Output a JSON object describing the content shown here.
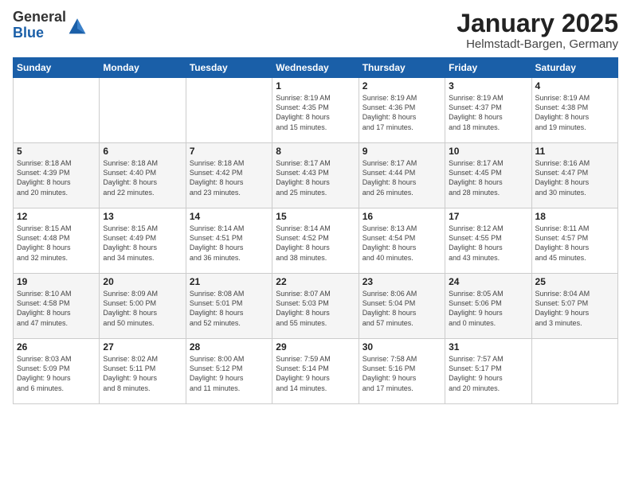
{
  "logo": {
    "general": "General",
    "blue": "Blue"
  },
  "header": {
    "month": "January 2025",
    "location": "Helmstadt-Bargen, Germany"
  },
  "weekdays": [
    "Sunday",
    "Monday",
    "Tuesday",
    "Wednesday",
    "Thursday",
    "Friday",
    "Saturday"
  ],
  "weeks": [
    [
      {
        "day": "",
        "info": ""
      },
      {
        "day": "",
        "info": ""
      },
      {
        "day": "",
        "info": ""
      },
      {
        "day": "1",
        "info": "Sunrise: 8:19 AM\nSunset: 4:35 PM\nDaylight: 8 hours\nand 15 minutes."
      },
      {
        "day": "2",
        "info": "Sunrise: 8:19 AM\nSunset: 4:36 PM\nDaylight: 8 hours\nand 17 minutes."
      },
      {
        "day": "3",
        "info": "Sunrise: 8:19 AM\nSunset: 4:37 PM\nDaylight: 8 hours\nand 18 minutes."
      },
      {
        "day": "4",
        "info": "Sunrise: 8:19 AM\nSunset: 4:38 PM\nDaylight: 8 hours\nand 19 minutes."
      }
    ],
    [
      {
        "day": "5",
        "info": "Sunrise: 8:18 AM\nSunset: 4:39 PM\nDaylight: 8 hours\nand 20 minutes."
      },
      {
        "day": "6",
        "info": "Sunrise: 8:18 AM\nSunset: 4:40 PM\nDaylight: 8 hours\nand 22 minutes."
      },
      {
        "day": "7",
        "info": "Sunrise: 8:18 AM\nSunset: 4:42 PM\nDaylight: 8 hours\nand 23 minutes."
      },
      {
        "day": "8",
        "info": "Sunrise: 8:17 AM\nSunset: 4:43 PM\nDaylight: 8 hours\nand 25 minutes."
      },
      {
        "day": "9",
        "info": "Sunrise: 8:17 AM\nSunset: 4:44 PM\nDaylight: 8 hours\nand 26 minutes."
      },
      {
        "day": "10",
        "info": "Sunrise: 8:17 AM\nSunset: 4:45 PM\nDaylight: 8 hours\nand 28 minutes."
      },
      {
        "day": "11",
        "info": "Sunrise: 8:16 AM\nSunset: 4:47 PM\nDaylight: 8 hours\nand 30 minutes."
      }
    ],
    [
      {
        "day": "12",
        "info": "Sunrise: 8:15 AM\nSunset: 4:48 PM\nDaylight: 8 hours\nand 32 minutes."
      },
      {
        "day": "13",
        "info": "Sunrise: 8:15 AM\nSunset: 4:49 PM\nDaylight: 8 hours\nand 34 minutes."
      },
      {
        "day": "14",
        "info": "Sunrise: 8:14 AM\nSunset: 4:51 PM\nDaylight: 8 hours\nand 36 minutes."
      },
      {
        "day": "15",
        "info": "Sunrise: 8:14 AM\nSunset: 4:52 PM\nDaylight: 8 hours\nand 38 minutes."
      },
      {
        "day": "16",
        "info": "Sunrise: 8:13 AM\nSunset: 4:54 PM\nDaylight: 8 hours\nand 40 minutes."
      },
      {
        "day": "17",
        "info": "Sunrise: 8:12 AM\nSunset: 4:55 PM\nDaylight: 8 hours\nand 43 minutes."
      },
      {
        "day": "18",
        "info": "Sunrise: 8:11 AM\nSunset: 4:57 PM\nDaylight: 8 hours\nand 45 minutes."
      }
    ],
    [
      {
        "day": "19",
        "info": "Sunrise: 8:10 AM\nSunset: 4:58 PM\nDaylight: 8 hours\nand 47 minutes."
      },
      {
        "day": "20",
        "info": "Sunrise: 8:09 AM\nSunset: 5:00 PM\nDaylight: 8 hours\nand 50 minutes."
      },
      {
        "day": "21",
        "info": "Sunrise: 8:08 AM\nSunset: 5:01 PM\nDaylight: 8 hours\nand 52 minutes."
      },
      {
        "day": "22",
        "info": "Sunrise: 8:07 AM\nSunset: 5:03 PM\nDaylight: 8 hours\nand 55 minutes."
      },
      {
        "day": "23",
        "info": "Sunrise: 8:06 AM\nSunset: 5:04 PM\nDaylight: 8 hours\nand 57 minutes."
      },
      {
        "day": "24",
        "info": "Sunrise: 8:05 AM\nSunset: 5:06 PM\nDaylight: 9 hours\nand 0 minutes."
      },
      {
        "day": "25",
        "info": "Sunrise: 8:04 AM\nSunset: 5:07 PM\nDaylight: 9 hours\nand 3 minutes."
      }
    ],
    [
      {
        "day": "26",
        "info": "Sunrise: 8:03 AM\nSunset: 5:09 PM\nDaylight: 9 hours\nand 6 minutes."
      },
      {
        "day": "27",
        "info": "Sunrise: 8:02 AM\nSunset: 5:11 PM\nDaylight: 9 hours\nand 8 minutes."
      },
      {
        "day": "28",
        "info": "Sunrise: 8:00 AM\nSunset: 5:12 PM\nDaylight: 9 hours\nand 11 minutes."
      },
      {
        "day": "29",
        "info": "Sunrise: 7:59 AM\nSunset: 5:14 PM\nDaylight: 9 hours\nand 14 minutes."
      },
      {
        "day": "30",
        "info": "Sunrise: 7:58 AM\nSunset: 5:16 PM\nDaylight: 9 hours\nand 17 minutes."
      },
      {
        "day": "31",
        "info": "Sunrise: 7:57 AM\nSunset: 5:17 PM\nDaylight: 9 hours\nand 20 minutes."
      },
      {
        "day": "",
        "info": ""
      }
    ]
  ]
}
